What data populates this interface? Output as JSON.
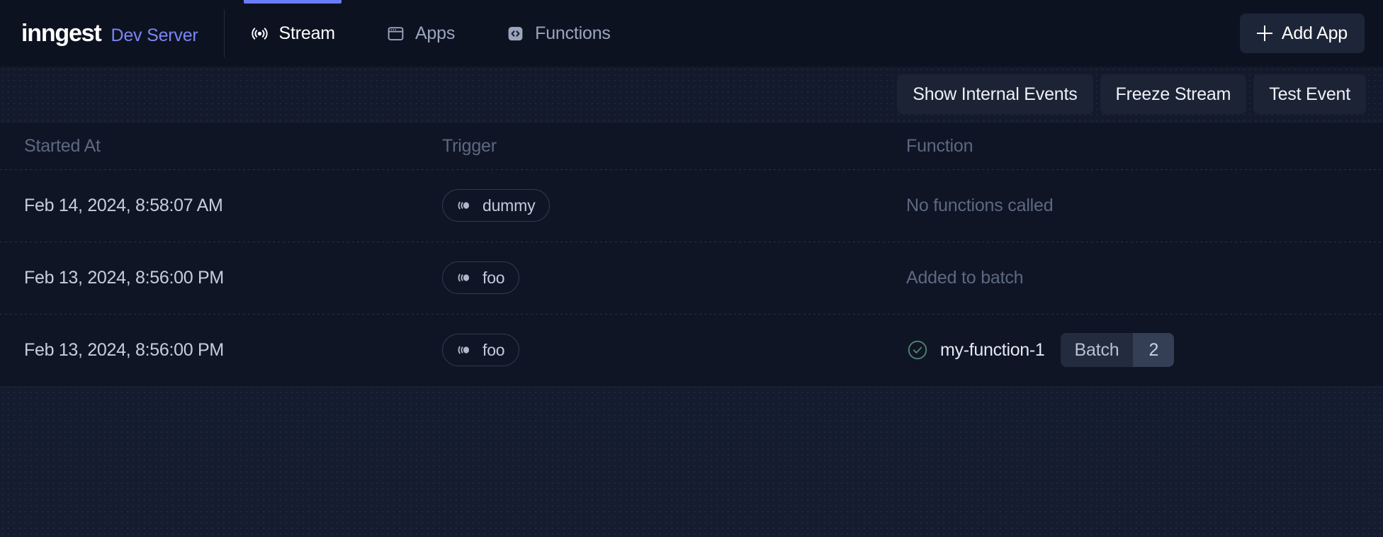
{
  "header": {
    "logo": "inngest",
    "subtitle": "Dev Server",
    "nav": [
      {
        "label": "Stream",
        "icon": "broadcast-icon",
        "active": true
      },
      {
        "label": "Apps",
        "icon": "window-icon",
        "active": false
      },
      {
        "label": "Functions",
        "icon": "code-brackets-icon",
        "active": false
      }
    ],
    "add_app_label": "Add App",
    "add_app_icon": "plus-icon"
  },
  "toolbar": {
    "buttons": [
      {
        "label": "Show Internal Events"
      },
      {
        "label": "Freeze Stream"
      },
      {
        "label": "Test Event"
      }
    ]
  },
  "table": {
    "columns": [
      "Started At",
      "Trigger",
      "Function"
    ],
    "rows": [
      {
        "started_at": "Feb 14, 2024, 8:58:07 AM",
        "trigger": "dummy",
        "trigger_icon": "broadcast-icon",
        "function_status": "none",
        "function_text": "No functions called"
      },
      {
        "started_at": "Feb 13, 2024, 8:56:00 PM",
        "trigger": "foo",
        "trigger_icon": "broadcast-icon",
        "function_status": "none",
        "function_text": "Added to batch"
      },
      {
        "started_at": "Feb 13, 2024, 8:56:00 PM",
        "trigger": "foo",
        "trigger_icon": "broadcast-icon",
        "function_status": "completed",
        "function_icon": "check-circle-icon",
        "function_name": "my-function-1",
        "batch_label": "Batch",
        "batch_count": "2"
      }
    ]
  },
  "colors": {
    "page_background": "#121829",
    "header_background": "#0d1221",
    "table_background": "#0f1524",
    "accent_purple": "#6b7cf9",
    "brand_sub": "#7b86f2",
    "success_green": "#4e7d6c",
    "muted_text": "#5d6882"
  }
}
